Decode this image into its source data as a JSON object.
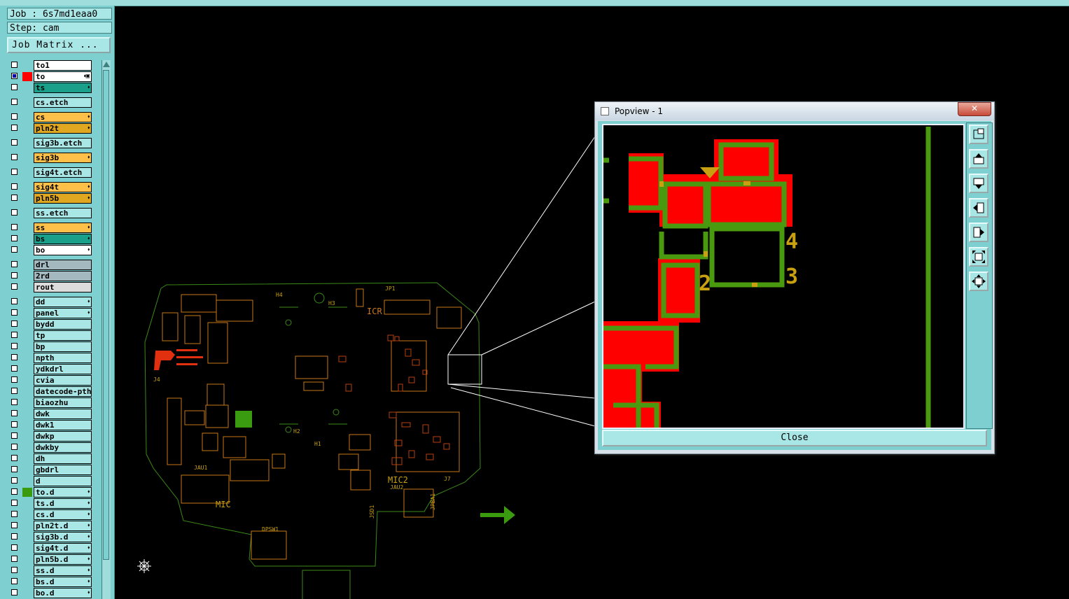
{
  "job_label": "Job : 6s7md1eaa0",
  "step_label": "Step: cam",
  "job_matrix_button": "Job Matrix ...",
  "layers": [
    {
      "name": "to1",
      "bg": "#ffffff",
      "sw": "",
      "sel": false,
      "mark": ""
    },
    {
      "name": "to",
      "bg": "#ffffff",
      "sw": "#ff0000",
      "sel": true,
      "mark": "⬪▣"
    },
    {
      "name": "ts",
      "bg": "#1aa08a",
      "sw": "",
      "sel": false,
      "mark": "⬪"
    },
    {
      "gap": true
    },
    {
      "name": "cs.etch",
      "bg": "#a9e6e6",
      "sw": "",
      "sel": false,
      "mark": ""
    },
    {
      "gap": true
    },
    {
      "name": "cs",
      "bg": "#ffc04a",
      "sw": "",
      "sel": false,
      "mark": "⬪"
    },
    {
      "name": "pln2t",
      "bg": "#e0a820",
      "sw": "",
      "sel": false,
      "mark": "⬪"
    },
    {
      "gap": true
    },
    {
      "name": "sig3b.etch",
      "bg": "#a9e6e6",
      "sw": "",
      "sel": false,
      "mark": ""
    },
    {
      "gap": true
    },
    {
      "name": "sig3b",
      "bg": "#ffc04a",
      "sw": "",
      "sel": false,
      "mark": "⬪"
    },
    {
      "gap": true
    },
    {
      "name": "sig4t.etch",
      "bg": "#a9e6e6",
      "sw": "",
      "sel": false,
      "mark": ""
    },
    {
      "gap": true
    },
    {
      "name": "sig4t",
      "bg": "#ffc04a",
      "sw": "",
      "sel": false,
      "mark": "⬪"
    },
    {
      "name": "pln5b",
      "bg": "#e0a820",
      "sw": "",
      "sel": false,
      "mark": "⬪"
    },
    {
      "gap": true
    },
    {
      "name": "ss.etch",
      "bg": "#a9e6e6",
      "sw": "",
      "sel": false,
      "mark": ""
    },
    {
      "gap": true
    },
    {
      "name": "ss",
      "bg": "#ffc04a",
      "sw": "",
      "sel": false,
      "mark": "⬪"
    },
    {
      "name": "bs",
      "bg": "#1aa08a",
      "sw": "",
      "sel": false,
      "mark": "⬪"
    },
    {
      "name": "bo",
      "bg": "#ffffff",
      "sw": "",
      "sel": false,
      "mark": "⬪"
    },
    {
      "gap": true
    },
    {
      "name": "drl",
      "bg": "#a4b8c0",
      "sw": "",
      "sel": false,
      "mark": ""
    },
    {
      "name": "2rd",
      "bg": "#a4b8c0",
      "sw": "",
      "sel": false,
      "mark": ""
    },
    {
      "name": "rout",
      "bg": "#dcdcdc",
      "sw": "",
      "sel": false,
      "mark": ""
    },
    {
      "gap": true
    },
    {
      "name": "dd",
      "bg": "#a9e6e6",
      "sw": "",
      "sel": false,
      "mark": "⬪"
    },
    {
      "name": "panel",
      "bg": "#a9e6e6",
      "sw": "",
      "sel": false,
      "mark": "⬪"
    },
    {
      "name": "bydd",
      "bg": "#a9e6e6",
      "sw": "",
      "sel": false,
      "mark": ""
    },
    {
      "name": "tp",
      "bg": "#a9e6e6",
      "sw": "",
      "sel": false,
      "mark": ""
    },
    {
      "name": "bp",
      "bg": "#a9e6e6",
      "sw": "",
      "sel": false,
      "mark": ""
    },
    {
      "name": "npth",
      "bg": "#a9e6e6",
      "sw": "",
      "sel": false,
      "mark": ""
    },
    {
      "name": "ydkdrl",
      "bg": "#a9e6e6",
      "sw": "",
      "sel": false,
      "mark": ""
    },
    {
      "name": "cvia",
      "bg": "#a9e6e6",
      "sw": "",
      "sel": false,
      "mark": ""
    },
    {
      "name": "datecode-pth",
      "bg": "#a9e6e6",
      "sw": "",
      "sel": false,
      "mark": ""
    },
    {
      "name": "biaozhu",
      "bg": "#a9e6e6",
      "sw": "",
      "sel": false,
      "mark": ""
    },
    {
      "name": "dwk",
      "bg": "#a9e6e6",
      "sw": "",
      "sel": false,
      "mark": ""
    },
    {
      "name": "dwk1",
      "bg": "#a9e6e6",
      "sw": "",
      "sel": false,
      "mark": ""
    },
    {
      "name": "dwkp",
      "bg": "#a9e6e6",
      "sw": "",
      "sel": false,
      "mark": ""
    },
    {
      "name": "dwkby",
      "bg": "#a9e6e6",
      "sw": "",
      "sel": false,
      "mark": ""
    },
    {
      "name": "dh",
      "bg": "#a9e6e6",
      "sw": "",
      "sel": false,
      "mark": ""
    },
    {
      "name": "gbdrl",
      "bg": "#a9e6e6",
      "sw": "",
      "sel": false,
      "mark": ""
    },
    {
      "name": "d",
      "bg": "#a9e6e6",
      "sw": "",
      "sel": false,
      "mark": ""
    },
    {
      "name": "to.d",
      "bg": "#a9e6e6",
      "sw": "#3a9a10",
      "sel": false,
      "mark": "⬪"
    },
    {
      "name": "ts.d",
      "bg": "#a9e6e6",
      "sw": "",
      "sel": false,
      "mark": "⬪"
    },
    {
      "name": "cs.d",
      "bg": "#a9e6e6",
      "sw": "",
      "sel": false,
      "mark": "⬪"
    },
    {
      "name": "pln2t.d",
      "bg": "#a9e6e6",
      "sw": "",
      "sel": false,
      "mark": "⬪"
    },
    {
      "name": "sig3b.d",
      "bg": "#a9e6e6",
      "sw": "",
      "sel": false,
      "mark": "⬪"
    },
    {
      "name": "sig4t.d",
      "bg": "#a9e6e6",
      "sw": "",
      "sel": false,
      "mark": "⬪"
    },
    {
      "name": "pln5b.d",
      "bg": "#a9e6e6",
      "sw": "",
      "sel": false,
      "mark": "⬪"
    },
    {
      "name": "ss.d",
      "bg": "#a9e6e6",
      "sw": "",
      "sel": false,
      "mark": "⬪"
    },
    {
      "name": "bs.d",
      "bg": "#a9e6e6",
      "sw": "",
      "sel": false,
      "mark": "⬪"
    },
    {
      "name": "bo.d",
      "bg": "#a9e6e6",
      "sw": "",
      "sel": false,
      "mark": "⬪"
    }
  ],
  "pcb_labels": {
    "h4": "H4",
    "h3": "H3",
    "jp1": "JP1",
    "icr": "ICR",
    "h2": "H2",
    "h1": "H1",
    "j4": "J4",
    "jau1": "JAU1",
    "mic": "MIC",
    "mic2": "MIC2",
    "jau2": "JAU2",
    "j7": "J7",
    "jpba1": "JPBA1",
    "jsd1": "JSD1",
    "dpsw1": "DPSW1"
  },
  "popup": {
    "title": "Popview - 1",
    "close_label": "Close",
    "pad_numbers": [
      "4",
      "3",
      "2"
    ]
  },
  "colors": {
    "copper": "#4a9a10",
    "mask": "#ff0000",
    "silk": "#c8a010",
    "outline": "#3a8a18"
  }
}
